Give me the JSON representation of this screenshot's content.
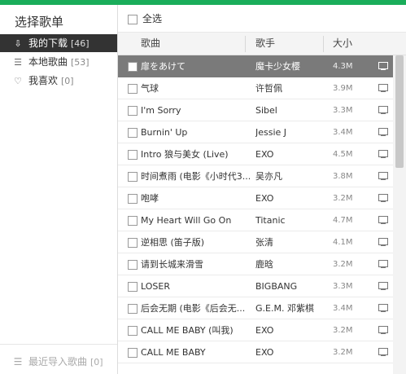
{
  "sidebar": {
    "title": "选择歌单",
    "items": [
      {
        "label": "我的下载",
        "count": "[46]",
        "icon": "download-icon",
        "glyph": "⇩"
      },
      {
        "label": "本地歌曲",
        "count": "[53]",
        "icon": "list-icon",
        "glyph": "☰"
      },
      {
        "label": "我喜欢",
        "count": "[0]",
        "icon": "heart-icon",
        "glyph": "♡"
      }
    ],
    "recent": {
      "label": "最近导入歌曲",
      "count": "[0]",
      "glyph": "☰"
    }
  },
  "main": {
    "select_all_label": "全选",
    "columns": {
      "song": "歌曲",
      "singer": "歌手",
      "size": "大小"
    },
    "rows": [
      {
        "song": "扉をあけて",
        "singer": "魔卡少女樱",
        "size": "4.3M"
      },
      {
        "song": "气球",
        "singer": "许哲佩",
        "size": "3.9M"
      },
      {
        "song": "I'm Sorry",
        "singer": "Sibel",
        "size": "3.3M"
      },
      {
        "song": "Burnin' Up",
        "singer": "Jessie J",
        "size": "3.4M"
      },
      {
        "song": "Intro  狼与美女 (Live)",
        "singer": "EXO",
        "size": "4.5M"
      },
      {
        "song": "时间煮雨 (电影《小时代3...",
        "singer": "吴亦凡",
        "size": "3.8M"
      },
      {
        "song": "咆哮",
        "singer": "EXO",
        "size": "3.2M"
      },
      {
        "song": "My Heart Will Go On",
        "singer": "Titanic",
        "size": "4.7M"
      },
      {
        "song": "逆相思 (笛子版)",
        "singer": "张清",
        "size": "4.1M"
      },
      {
        "song": "请到长城来滑雪",
        "singer": "鹿晗",
        "size": "3.2M"
      },
      {
        "song": "LOSER",
        "singer": "BIGBANG",
        "size": "3.3M"
      },
      {
        "song": "后会无期 (电影《后会无...",
        "singer": "G.E.M. 邓紫棋",
        "size": "3.4M"
      },
      {
        "song": "CALL ME BABY (叫我)",
        "singer": "EXO",
        "size": "3.2M"
      },
      {
        "song": "CALL ME BABY",
        "singer": "EXO",
        "size": "3.2M"
      }
    ],
    "active_row": 0
  }
}
